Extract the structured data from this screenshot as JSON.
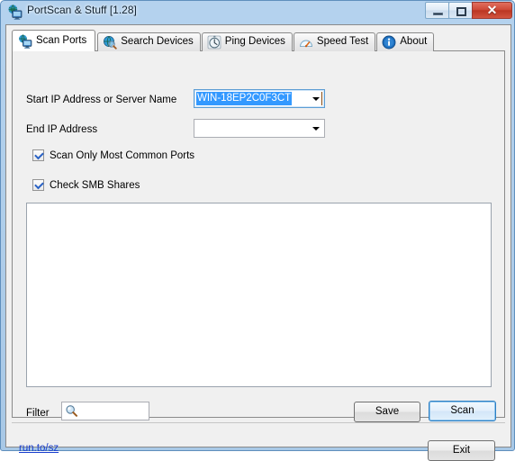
{
  "window": {
    "title": "PortScan & Stuff [1.28]",
    "icon": "network-computer-icon",
    "controls": {
      "minimize": "minimize-icon",
      "restore": "restore-icon",
      "close": "✕"
    }
  },
  "tabs": [
    {
      "label": "Scan Ports",
      "icon": "monitor-globe-icon",
      "active": true
    },
    {
      "label": "Search Devices",
      "icon": "globe-magnifier-icon",
      "active": false
    },
    {
      "label": "Ping Devices",
      "icon": "stopwatch-icon",
      "active": false
    },
    {
      "label": "Speed Test",
      "icon": "gauge-icon",
      "active": false
    },
    {
      "label": "About",
      "icon": "info-circle-icon",
      "active": false
    }
  ],
  "scan_ports": {
    "start_ip_label": "Start IP Address or Server Name",
    "start_ip_value": "WIN-18EP2C0F3CT",
    "start_ip_selected": true,
    "end_ip_label": "End IP Address",
    "end_ip_value": "",
    "checkboxes": [
      {
        "label": "Scan Only Most Common Ports",
        "checked": true
      },
      {
        "label": "Check SMB Shares",
        "checked": true
      }
    ],
    "results": [],
    "filter_label": "Filter",
    "filter_value": "",
    "filter_icon": "search-icon",
    "save_label": "Save",
    "scan_label": "Scan"
  },
  "footer": {
    "link_text": "run.to/sz",
    "exit_label": "Exit"
  },
  "colors": {
    "selection_blue": "#3399ff",
    "link_blue": "#1a3fcf",
    "close_red": "#cf4a38",
    "focus_blue": "#2c7fc4"
  }
}
